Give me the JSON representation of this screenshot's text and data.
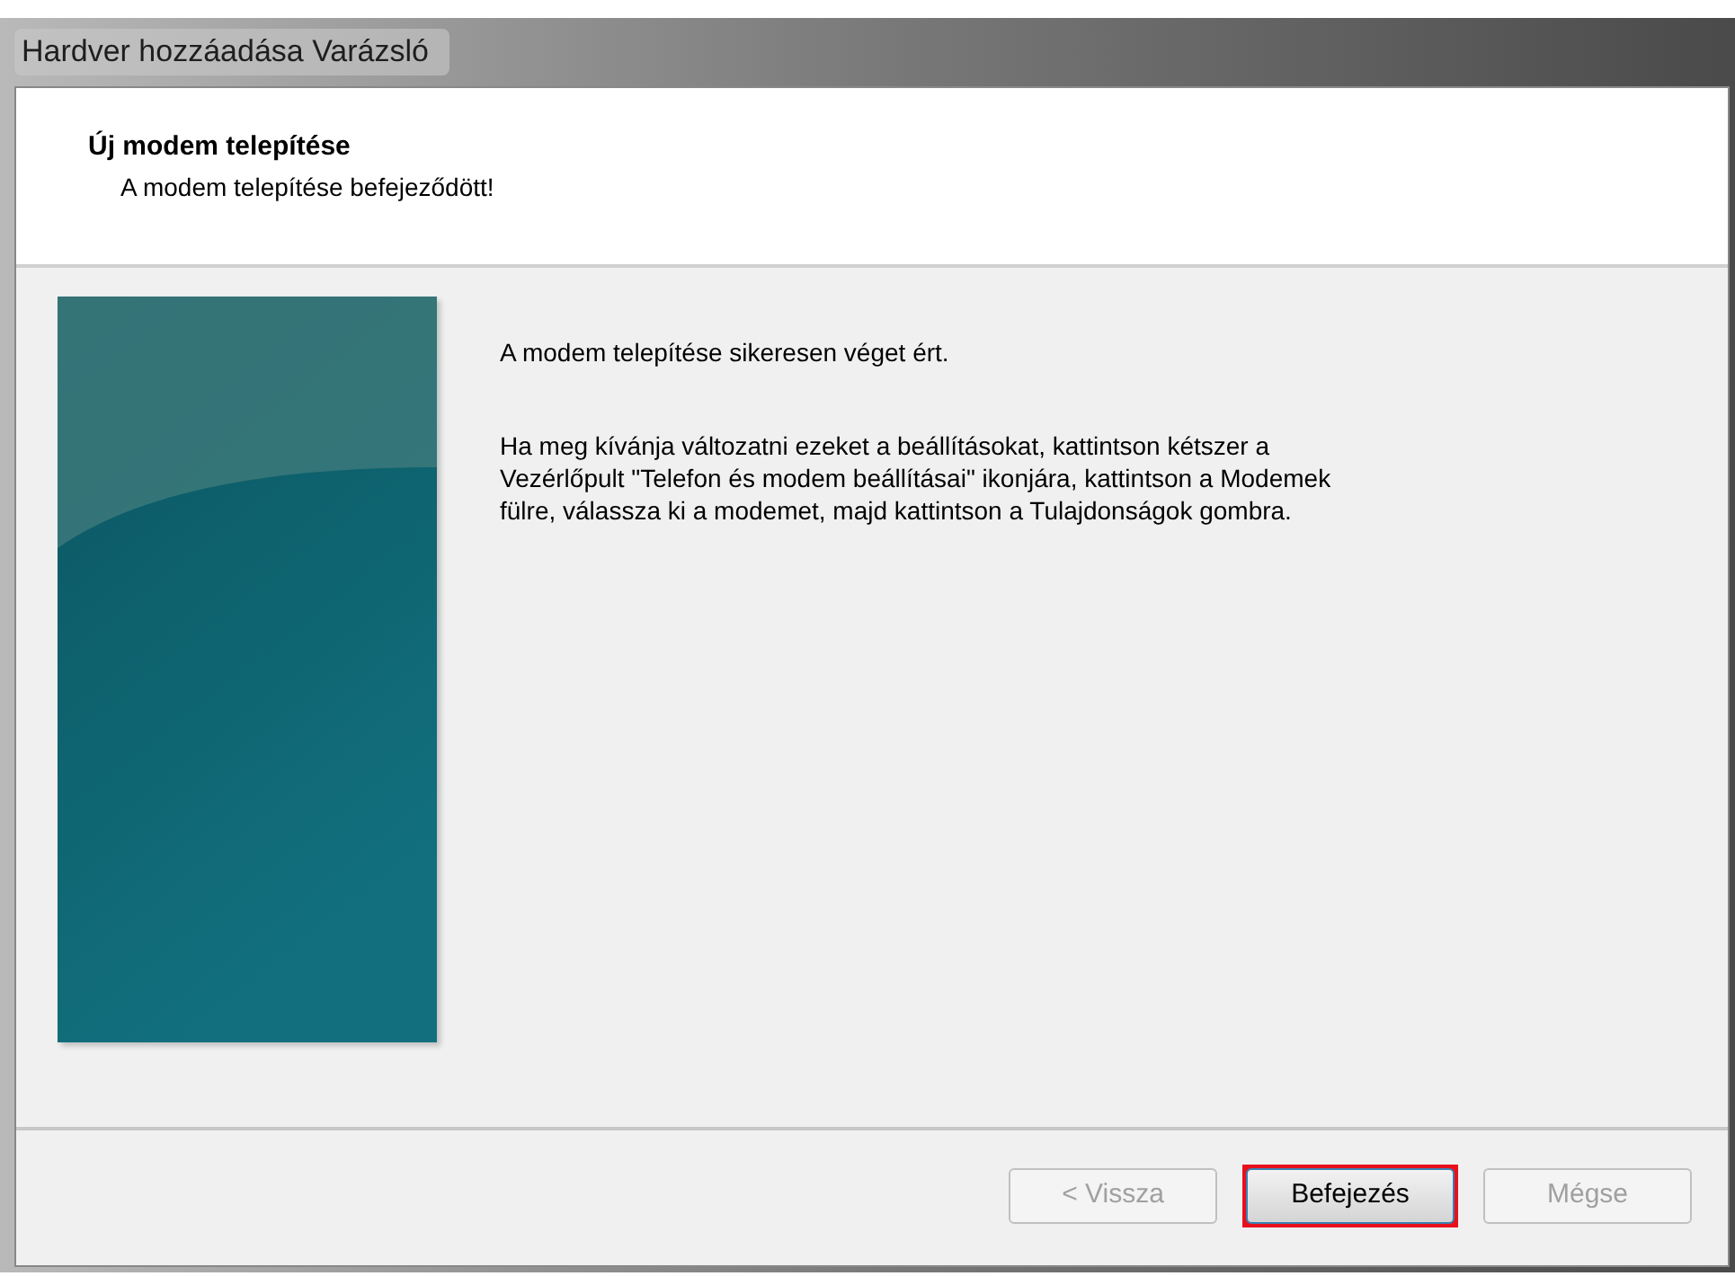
{
  "window": {
    "title": "Hardver hozzáadása Varázsló"
  },
  "header": {
    "title": "Új modem telepítése",
    "subtitle": "A modem telepítése befejeződött!"
  },
  "body": {
    "paragraphs": [
      "A modem telepítése sikeresen véget ért.",
      "Ha meg kívánja változatni ezeket a beállításokat, kattintson kétszer a Vezérlőpult \"Telefon és modem beállításai\" ikonjára, kattintson a Modemek fülre, válassza ki a modemet, majd kattintson a Tulajdonságok gombra."
    ]
  },
  "buttons": [
    {
      "label": "< Vissza",
      "disabled": true,
      "highlighted": false
    },
    {
      "label": "Befejezés",
      "disabled": false,
      "highlighted": true
    },
    {
      "label": "Mégse",
      "disabled": true,
      "highlighted": false
    }
  ]
}
